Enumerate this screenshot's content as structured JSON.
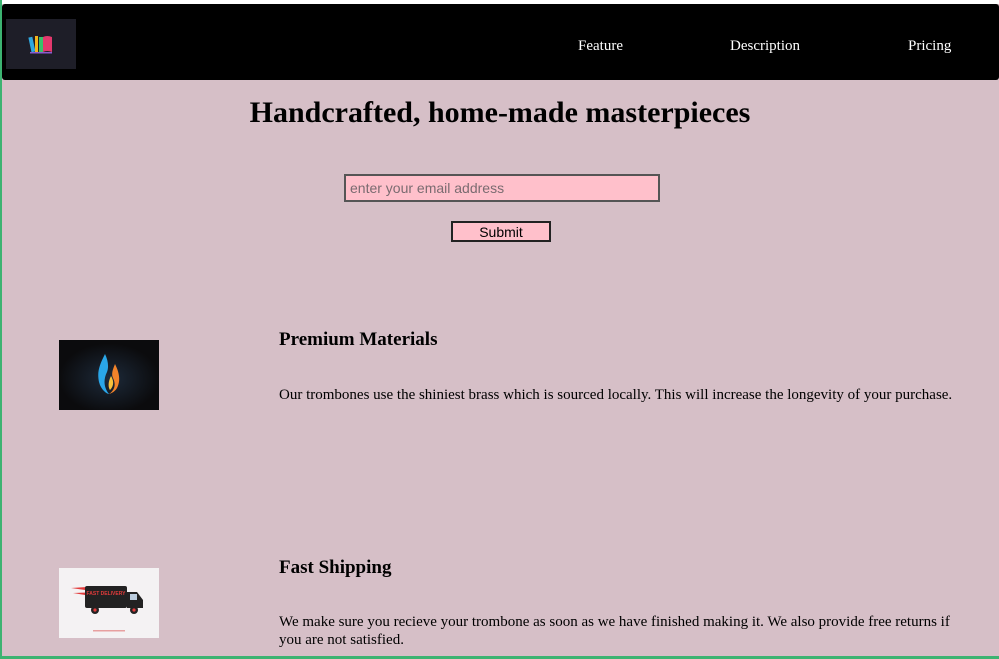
{
  "header": {
    "logo_icon": "colorful-books-icon",
    "nav": [
      {
        "label": "Feature"
      },
      {
        "label": "Description"
      },
      {
        "label": "Pricing"
      }
    ]
  },
  "hero": {
    "title": "Handcrafted, home-made masterpieces",
    "email_placeholder": "enter your email address",
    "email_value": "",
    "submit_label": "Submit"
  },
  "features": [
    {
      "icon": "flame-icon",
      "title": "Premium Materials",
      "text": "Our trombones use the shiniest brass which is sourced locally. This will increase the longevity of your purchase."
    },
    {
      "icon": "delivery-truck-icon",
      "title": "Fast Shipping",
      "text": "We make sure you recieve your trombone as soon as we have finished making it. We also provide free returns if you are not satisfied.",
      "truck_label": "FAST DELIVERY"
    }
  ],
  "colors": {
    "page_bg": "#d6bfc7",
    "header_bg": "#000000",
    "input_bg": "#ffc0cb",
    "frame_accent": "#3cb371"
  }
}
